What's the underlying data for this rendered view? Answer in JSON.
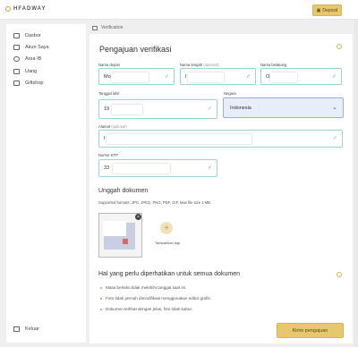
{
  "header": {
    "logo": "HFADWAY",
    "deposit_label": "Deposit"
  },
  "sidebar": {
    "items": [
      {
        "label": "Dasbor",
        "icon": "dashboard-icon"
      },
      {
        "label": "Akun Saya",
        "icon": "account-icon"
      },
      {
        "label": "Area IB",
        "icon": "partner-icon"
      },
      {
        "label": "Uang",
        "icon": "wallet-icon"
      },
      {
        "label": "Giftshop",
        "icon": "gift-icon"
      }
    ],
    "logout_label": "Keluar"
  },
  "breadcrumb": "Verification",
  "form": {
    "title": "Pengajuan verifikasi",
    "first_name": {
      "label": "Nama depan",
      "value": "Mo"
    },
    "middle_name": {
      "label": "Nama tengah",
      "optional": "(optional)",
      "value": "I"
    },
    "last_name": {
      "label": "Nama belakang",
      "value": "O"
    },
    "birth_date": {
      "label": "Tanggal lahir",
      "value": "19"
    },
    "country": {
      "label": "Negara",
      "value": "Indonesia"
    },
    "address": {
      "label": "Alamat",
      "optional": "(optional)",
      "value": "I"
    },
    "ktp": {
      "label": "Nomor KTP",
      "value": "33"
    }
  },
  "upload": {
    "title": "Unggah dokumen",
    "formats": "Supported formats: JPG, JPEG, PNG, PDF, GIF. Max file size 1 MB.",
    "add_more": "Tambahkan lagi"
  },
  "notes": {
    "title": "Hal yang perlu diperhatikan untuk semua dokumen",
    "items": [
      "Masa berlaku tidak melebihi tanggal saat ini.",
      "Foto tidak pernah dimodifikasi menggunakan editor grafis.",
      "Dokumen terlihat dengan jelas, foto tidak kabur."
    ]
  },
  "submit_label": "Kirim pengajuan",
  "colors": {
    "accent": "#e7c86c",
    "field_border": "#9fd3cf",
    "select_bg": "#e7eefa"
  }
}
